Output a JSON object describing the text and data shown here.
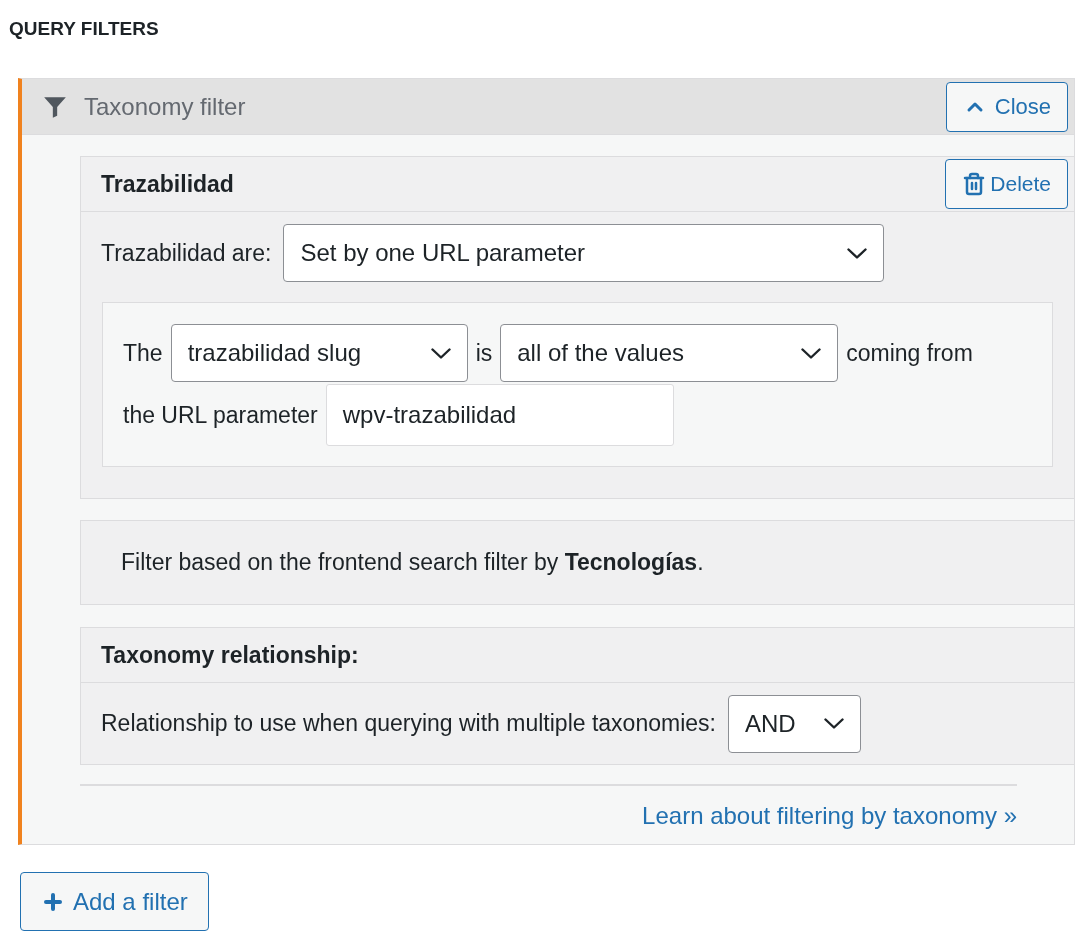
{
  "heading": "QUERY FILTERS",
  "filter_panel": {
    "title": "Taxonomy filter",
    "close_button": "Close",
    "taxonomy_section": {
      "title": "Trazabilidad",
      "delete_button": "Delete",
      "mode_label": "Trazabilidad are:",
      "mode_select": "Set by one URL parameter",
      "sentence": {
        "text_1": "The",
        "field_select": "trazabilidad slug",
        "text_2": "is",
        "match_select": "all of the values",
        "text_3": "coming from",
        "text_4": "the URL parameter",
        "parameter_input": "wpv-trazabilidad"
      }
    },
    "description": "Filter based on the frontend search filter by **Tecnologías**.",
    "relationship_section": {
      "title": "Taxonomy relationship:",
      "label": "Relationship to use when querying with multiple taxonomies:",
      "select": "AND"
    },
    "learn_link": "Learn about filtering by taxonomy »"
  },
  "add_button": "Add a filter"
}
